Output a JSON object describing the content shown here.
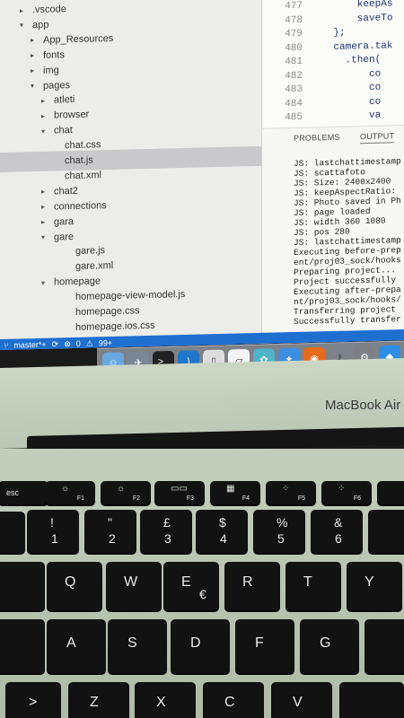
{
  "explorer": {
    "items": [
      {
        "label": ".vscode",
        "arrow": "▸",
        "indent": 0
      },
      {
        "label": "app",
        "arrow": "▾",
        "indent": 0
      },
      {
        "label": "App_Resources",
        "arrow": "▸",
        "indent": 1
      },
      {
        "label": "fonts",
        "arrow": "▸",
        "indent": 1
      },
      {
        "label": "img",
        "arrow": "▸",
        "indent": 1
      },
      {
        "label": "pages",
        "arrow": "▾",
        "indent": 1
      },
      {
        "label": "atleti",
        "arrow": "▸",
        "indent": 2
      },
      {
        "label": "browser",
        "arrow": "▸",
        "indent": 2
      },
      {
        "label": "chat",
        "arrow": "▾",
        "indent": 2
      },
      {
        "label": "chat.css",
        "arrow": "",
        "indent": 3
      },
      {
        "label": "chat.js",
        "arrow": "",
        "indent": 3,
        "selected": true
      },
      {
        "label": "chat.xml",
        "arrow": "",
        "indent": 3
      },
      {
        "label": "chat2",
        "arrow": "▸",
        "indent": 2
      },
      {
        "label": "connections",
        "arrow": "▸",
        "indent": 2
      },
      {
        "label": "gara",
        "arrow": "▸",
        "indent": 2
      },
      {
        "label": "gare",
        "arrow": "▾",
        "indent": 2
      },
      {
        "label": "gare.js",
        "arrow": "",
        "indent": 4
      },
      {
        "label": "gare.xml",
        "arrow": "",
        "indent": 4
      },
      {
        "label": "homepage",
        "arrow": "▾",
        "indent": 2
      },
      {
        "label": "homepage-view-model.js",
        "arrow": "",
        "indent": 4
      },
      {
        "label": "homepage.css",
        "arrow": "",
        "indent": 4
      },
      {
        "label": "homepage.ios.css",
        "arrow": "",
        "indent": 4
      }
    ]
  },
  "editor": {
    "lines": [
      {
        "num": "477",
        "text": "        keepAs"
      },
      {
        "num": "478",
        "text": "        saveTo"
      },
      {
        "num": "479",
        "text": "    };"
      },
      {
        "num": "480",
        "text": "    camera.tak"
      },
      {
        "num": "481",
        "text": "      .then("
      },
      {
        "num": "482",
        "text": "          co"
      },
      {
        "num": "483",
        "text": "          co"
      },
      {
        "num": "484",
        "text": "          co"
      },
      {
        "num": "485",
        "text": "          va"
      }
    ]
  },
  "panel": {
    "tabs": [
      "PROBLEMS",
      "OUTPUT"
    ],
    "lines": [
      "JS: lastchattimestamp",
      "JS: scattafoto",
      "JS: Size: 2400x2400",
      "JS: keepAspectRatio:",
      "JS: Photo saved in Ph",
      "JS: page loaded",
      "JS: width 360 1080",
      "JS: pos 280",
      "JS: lastchattimestamp",
      "Executing before-prep",
      "ent/proj03_sock/hooks",
      "Preparing project...",
      "Project successfully",
      "Executing after-prepa",
      "nt/proj03_sock/hooks/",
      "Transferring project",
      "Successfully transfer"
    ]
  },
  "statusbar": {
    "branch": "master*+",
    "errors": "0",
    "warnings": "99+"
  },
  "laptop": {
    "brand": "MacBook Air"
  },
  "keys": {
    "fn": [
      {
        "label": "esc"
      },
      {
        "label": "F1",
        "icon": "☼"
      },
      {
        "label": "F2",
        "icon": "☼"
      },
      {
        "label": "F3",
        "icon": "▭▭"
      },
      {
        "label": "F4",
        "icon": "▦"
      },
      {
        "label": "F5",
        "icon": "⁘"
      },
      {
        "label": "F6",
        "icon": "⁘"
      }
    ],
    "num": [
      {
        "top": "!",
        "bottom": "1"
      },
      {
        "top": "\"",
        "bottom": "2"
      },
      {
        "top": "£",
        "bottom": "3"
      },
      {
        "top": "$",
        "bottom": "4"
      },
      {
        "top": "%",
        "bottom": "5"
      },
      {
        "top": "&",
        "bottom": "6"
      }
    ],
    "qwerty": [
      "Q",
      "W",
      "E",
      "R",
      "T",
      "Y"
    ],
    "euro": "€",
    "asdf": [
      "A",
      "S",
      "D",
      "F",
      "G"
    ],
    "bottom": [
      ">",
      "Z",
      "X",
      "C",
      "V"
    ]
  },
  "colors": {
    "statusbar": "#1f6fd0",
    "selection": "#c9c9cb",
    "key": "#121212"
  }
}
